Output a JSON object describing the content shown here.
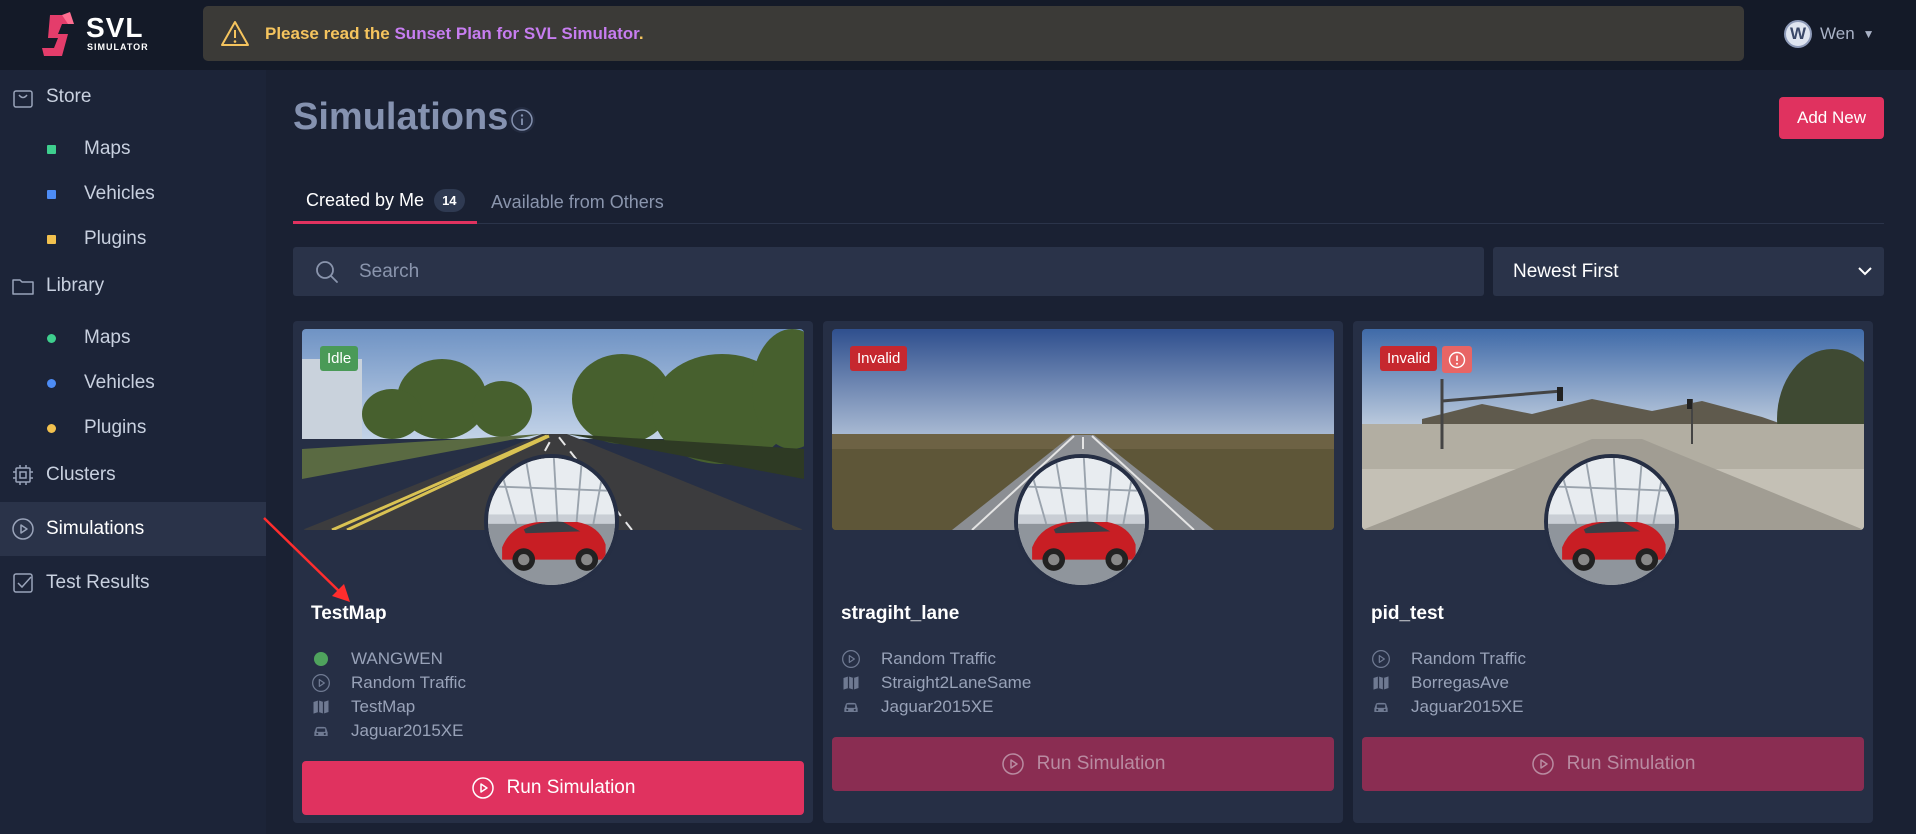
{
  "app": {
    "logo_text": "SVL",
    "logo_sub": "SIMULATOR"
  },
  "banner": {
    "prefix": "Please read the ",
    "link": "Sunset Plan for SVL Simulator",
    "suffix": "."
  },
  "user": {
    "initial": "W",
    "name": "Wen"
  },
  "sidebar": {
    "store": "Store",
    "store_items": [
      {
        "label": "Maps",
        "color": "#3ecf8e"
      },
      {
        "label": "Vehicles",
        "color": "#4d8cf5"
      },
      {
        "label": "Plugins",
        "color": "#f2c14e"
      }
    ],
    "library": "Library",
    "library_items": [
      {
        "label": "Maps",
        "color": "#3ecf8e"
      },
      {
        "label": "Vehicles",
        "color": "#4d8cf5"
      },
      {
        "label": "Plugins",
        "color": "#f2c14e"
      }
    ],
    "clusters": "Clusters",
    "simulations": "Simulations",
    "test_results": "Test Results"
  },
  "main": {
    "title": "Simulations",
    "add_new": "Add New",
    "tabs": [
      {
        "label": "Created by Me",
        "count": "14"
      },
      {
        "label": "Available from Others"
      }
    ],
    "search_placeholder": "Search",
    "sort_value": "Newest First"
  },
  "cards": [
    {
      "status": "Idle",
      "title": "TestMap",
      "owner": "WANGWEN",
      "scenario": "Random Traffic",
      "map": "TestMap",
      "vehicle": "Jaguar2015XE",
      "run_label": "Run Simulation"
    },
    {
      "status": "Invalid",
      "title": "stragiht_lane",
      "scenario": "Random Traffic",
      "map": "Straight2LaneSame",
      "vehicle": "Jaguar2015XE",
      "run_label": "Run Simulation"
    },
    {
      "status": "Invalid",
      "title": "pid_test",
      "scenario": "Random Traffic",
      "map": "BorregasAve",
      "vehicle": "Jaguar2015XE",
      "run_label": "Run Simulation"
    }
  ],
  "colors": {
    "accent": "#e0325f",
    "idle": "#4a9a57",
    "invalid": "#c6282f"
  }
}
